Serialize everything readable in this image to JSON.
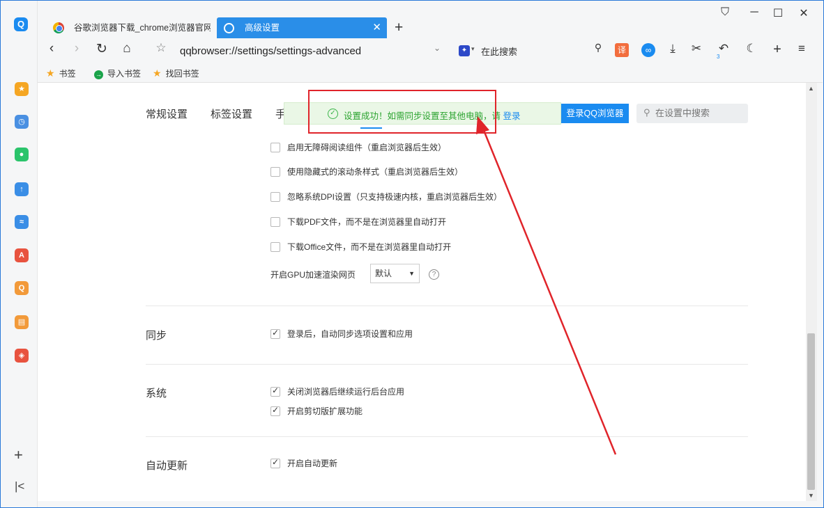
{
  "tabs": [
    {
      "title": "谷歌浏览器下载_chrome浏览器官网",
      "icon": "chrome-icon",
      "active": false
    },
    {
      "title": "高级设置",
      "icon": "settings-icon",
      "active": true
    }
  ],
  "toolbar": {
    "url": "qqbrowser://settings/settings-advanced",
    "search_placeholder": "在此搜索",
    "ze_label": "译",
    "undo_count": "3"
  },
  "bookmarks": [
    {
      "label": "书签",
      "icon": "star-icon"
    },
    {
      "label": "导入书签",
      "icon": "import-icon"
    },
    {
      "label": "找回书签",
      "icon": "star-icon"
    }
  ],
  "settings_tabs": [
    "常规设置",
    "标签设置",
    "手"
  ],
  "toast": {
    "message": "设置成功！如需同步设置至其他电脑，请",
    "link": "登录"
  },
  "login_button": "登录QQ浏览器",
  "settings_search_placeholder": "在设置中搜索",
  "advanced_options": [
    {
      "label": "启用无障碍阅读组件（重启浏览器后生效）",
      "checked": false
    },
    {
      "label": "使用隐藏式的滚动条样式（重启浏览器后生效）",
      "checked": false
    },
    {
      "label": "忽略系统DPI设置（只支持极速内核，重启浏览器后生效）",
      "checked": false
    },
    {
      "label": "下载PDF文件，而不是在浏览器里自动打开",
      "checked": false
    },
    {
      "label": "下载Office文件，而不是在浏览器里自动打开",
      "checked": false
    }
  ],
  "gpu": {
    "label": "开启GPU加速渲染网页",
    "value": "默认",
    "help": "?"
  },
  "sync": {
    "title": "同步",
    "options": [
      {
        "label": "登录后，自动同步选项设置和应用",
        "checked": true
      }
    ]
  },
  "system": {
    "title": "系统",
    "options": [
      {
        "label": "关闭浏览器后继续运行后台应用",
        "checked": true
      },
      {
        "label": "开启剪切版扩展功能",
        "checked": true
      }
    ]
  },
  "update": {
    "title": "自动更新",
    "options": [
      {
        "label": "开启自动更新",
        "checked": true
      }
    ]
  },
  "colors": {
    "accent": "#1a8bf0",
    "annotation": "#e0242a",
    "success": "#2aa32e"
  }
}
